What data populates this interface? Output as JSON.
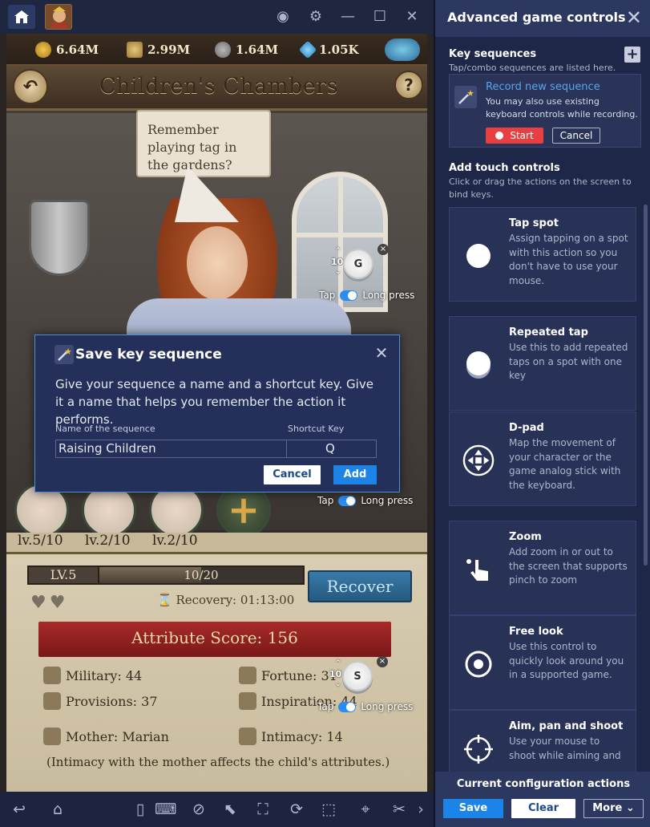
{
  "emulator": {
    "resources": [
      {
        "icon": "gold-coin-icon",
        "value": "6.64M"
      },
      {
        "icon": "grain-icon",
        "value": "2.99M"
      },
      {
        "icon": "soldiers-icon",
        "value": "1.64M"
      },
      {
        "icon": "diamond-icon",
        "value": "1.05K"
      }
    ],
    "scene_title": "Children's Chambers",
    "help_label": "?",
    "speech": "Remember playing tag in the gardens?",
    "children": [
      {
        "level": "lv.5/10"
      },
      {
        "level": "lv.2/10"
      },
      {
        "level": "lv.2/10"
      }
    ],
    "add_child_label": "+",
    "level_box": "LV.5",
    "exp": {
      "text": "10/20",
      "fraction": 0.5
    },
    "recover_label": "Recover",
    "recovery_text": "Recovery: 01:13:00",
    "attribute_score": "Attribute Score: 156",
    "attributes": {
      "military": "Military: 44",
      "fortune": "Fortune: 31",
      "provisions": "Provisions: 37",
      "inspiration": "Inspiration: 44",
      "mother": "Mother: Marian",
      "intimacy": "Intimacy: 14"
    },
    "intimacy_note": "(Intimacy with the mother affects the child's attributes.)"
  },
  "markers": [
    {
      "key": "G",
      "count": "10",
      "close": "×"
    },
    {
      "key": "S",
      "count": "10",
      "close": "×"
    }
  ],
  "toggles": {
    "tap": "Tap",
    "long_press": "Long press"
  },
  "modal": {
    "title": "Save key sequence",
    "close": "✕",
    "description": "Give your sequence a name and a shortcut key. Give it a name that helps you remember the action it performs.",
    "name_label": "Name of the sequence",
    "name_value": "Raising Children",
    "shortcut_label": "Shortcut Key",
    "shortcut_value": "Q",
    "cancel_label": "Cancel",
    "add_label": "Add"
  },
  "panel": {
    "title": "Advanced game controls",
    "close": "✕",
    "key_sequences": {
      "title": "Key sequences",
      "subtitle": "Tap/combo sequences are listed here.",
      "add": "+",
      "record_link": "Record new sequence",
      "record_note": "You may also use existing keyboard controls while recording.",
      "start_label": "Start",
      "cancel_label": "Cancel"
    },
    "touch": {
      "title": "Add touch controls",
      "subtitle": "Click or drag the actions on the screen to bind keys."
    },
    "cards": [
      {
        "title": "Tap spot",
        "desc": "Assign tapping on a spot with this action so you don't have to use your mouse.",
        "icon": "tap-spot-icon"
      },
      {
        "title": "Repeated tap",
        "desc": "Use this to add repeated taps on a spot with one key",
        "icon": "repeated-tap-icon"
      },
      {
        "title": "D-pad",
        "desc": "Map the movement of your character or the game analog stick with the keyboard.",
        "icon": "dpad-icon"
      },
      {
        "title": "Zoom",
        "desc": "Add zoom in or out to the screen that supports pinch to zoom",
        "icon": "zoom-icon"
      },
      {
        "title": "Free look",
        "desc": "Use this control to quickly look around you in a supported game.",
        "icon": "free-look-icon"
      },
      {
        "title": "Aim, pan and shoot",
        "desc": "Use your mouse to shoot while aiming and",
        "icon": "aim-icon"
      }
    ],
    "footer": {
      "title": "Current configuration actions",
      "save": "Save",
      "clear": "Clear",
      "more": "More ⌄"
    }
  }
}
